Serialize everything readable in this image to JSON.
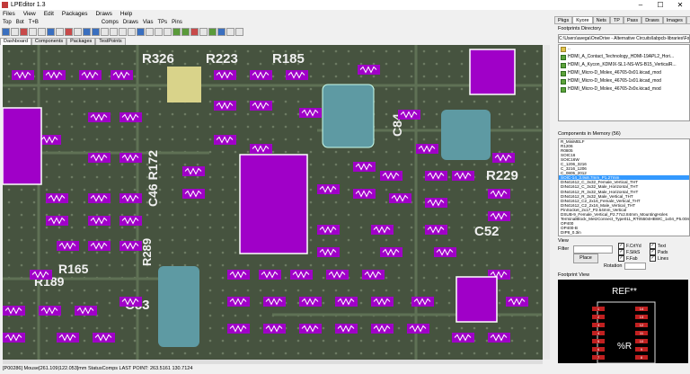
{
  "app": {
    "title": "LPEditor 1.3"
  },
  "menu": [
    "Files",
    "View",
    "Edit",
    "Packages",
    "Draws",
    "Help"
  ],
  "toolbar1": [
    "Top",
    "Bot",
    "T+B",
    "Comps",
    "Draws",
    "Vias",
    "TPs",
    "Pins"
  ],
  "doc_tabs": [
    "Dashboard",
    "Components",
    "Packages",
    "TestPoints"
  ],
  "right_tabs": [
    "Pkgs",
    "Kyore",
    "Nets",
    "TP",
    "Pass",
    "Draws",
    "Images",
    "AI"
  ],
  "footprints": {
    "title": "Footprints Directory",
    "dir": "C:\\Users\\avega\\OneDrive - Alternative Circuits\\labpcb-libraries\\Foo",
    "files": [
      "HDMI_A_Contact_Technology_HDMI-19APL2_Hori...",
      "HDMI_A_Kycon_KDMIX-SL1-NS-WS-B15_VerticalR...",
      "HDMI_Micro-D_Molex_46765-0x01.kicad_mod",
      "HDMI_Micro-D_Molex_46765-1x01.kicad_mod",
      "HDMI_Micro-D_Molex_46765-2x0x.kicad_mod"
    ]
  },
  "memory": {
    "title": "Components in Memory (56)",
    "items": [
      "R_MiniMELF",
      "R1206",
      "R0805",
      "SOIC16",
      "SOIC16W",
      "C_1206_3216",
      "C_3216_1206",
      "C_0805_2012",
      "SOIC-14_3.9x8.7mm_P1.27mm",
      "DIN41612_C_3x32_Female_Vertical_THT",
      "DIN41612_C_3x32_Male_Horizontal_THT",
      "DIN41612_R_3x32_Male_Horizontal_THT",
      "DIN41612_R_3x32_Male_Vertical_THT",
      "DIN41612_C2_2x16_Female_Vertical_THT",
      "DIN41612_C2_2x16_Male_Vertical_THT",
      "PinSocket_2x17_P2.54mm_Vertical",
      "DSUB-9_Female_Vertical_P2.77x2.84mm_MountingHoles",
      "TerminalBlock_MetzConnect_Type011_RT05504HBWC_1x04_P5.00m",
      "OP400",
      "OP400-B",
      "DIP8_0.3in"
    ],
    "selected_index": 8
  },
  "view": {
    "title": "View",
    "filter_label": "Filter",
    "place_label": "Place",
    "rotation_label": "Rotation",
    "checks_left": [
      "F.CrtYd",
      "F.SilkS",
      "F.Fab"
    ],
    "checks_right": [
      "Text",
      "Pads",
      "Lines"
    ]
  },
  "footprint_view": {
    "title": "Footprint View",
    "ref": "REF**",
    "value": "%R"
  },
  "status": "[P00286]   Mouse[261.109|122.053]mm   StatusComps   LAST POINT: 263.5161 130.7124",
  "colors": {
    "accent": "#0078d7",
    "component": "#a000c8",
    "pcb": "#3f4c3b"
  }
}
